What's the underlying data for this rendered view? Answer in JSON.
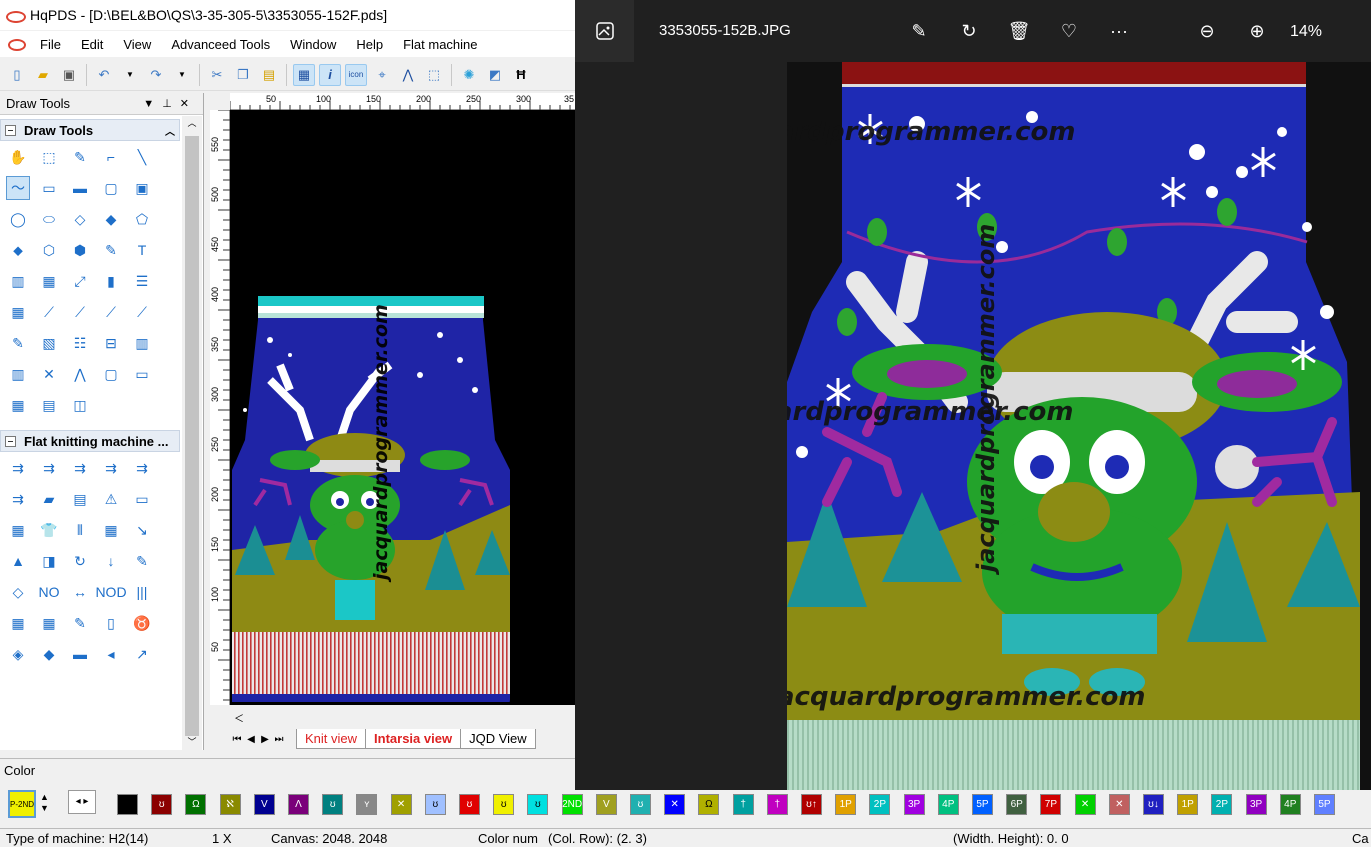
{
  "app": {
    "title": "HqPDS - [D:\\BEL&BO\\QS\\3-35-305-5\\3353055-152F.pds]",
    "menu": [
      "File",
      "Edit",
      "View",
      "Advanceed Tools",
      "Window",
      "Help",
      "Flat machine"
    ]
  },
  "toolbar": {
    "icons": [
      "new-file-icon",
      "open-folder-icon",
      "save-icon",
      "undo-icon",
      "redo-icon",
      "cut-icon",
      "copy-icon",
      "paste-icon",
      "grid-icon",
      "info-icon",
      "icon-mode-icon",
      "center-icon",
      "arc-icon",
      "select-icon",
      "snowflake-icon",
      "slash-icon",
      "h-icon"
    ]
  },
  "panel": {
    "title": "Draw Tools",
    "section_draw": "Draw Tools",
    "section_flat": "Flat knitting machine ...",
    "draw_tool_count": 43,
    "flat_tool_count": 35
  },
  "ruler": {
    "h_ticks": [
      "50",
      "100",
      "150",
      "200",
      "250",
      "300",
      "35"
    ],
    "v_ticks": [
      "550",
      "500",
      "450",
      "400",
      "350",
      "300",
      "250",
      "200",
      "150",
      "100",
      "50"
    ]
  },
  "tabs": {
    "knit": "Knit view",
    "intarsia": "Intarsia view",
    "jqd": "JQD View"
  },
  "color_panel": {
    "label": "Color",
    "current_label": "P-2ND",
    "swatches": [
      {
        "color": "#000000",
        "sym": ""
      },
      {
        "color": "#8b0000",
        "sym": "ʊ"
      },
      {
        "color": "#007000",
        "sym": "Ω"
      },
      {
        "color": "#8a8a00",
        "sym": "ℵ"
      },
      {
        "color": "#000090",
        "sym": "V"
      },
      {
        "color": "#7a007a",
        "sym": "Λ"
      },
      {
        "color": "#008080",
        "sym": "ʊ"
      },
      {
        "color": "#888888",
        "sym": "ʏ"
      },
      {
        "color": "#a0a000",
        "sym": "✕"
      },
      {
        "color": "#a0c0ff",
        "sym": "ʊ"
      },
      {
        "color": "#e00000",
        "sym": "ʊ"
      },
      {
        "color": "#f0f000",
        "sym": "ʊ"
      },
      {
        "color": "#00e0e0",
        "sym": "ʊ"
      },
      {
        "color": "#00e000",
        "sym": "2ND"
      },
      {
        "color": "#a0a020",
        "sym": "V"
      },
      {
        "color": "#20b0b0",
        "sym": "ʊ"
      },
      {
        "color": "#0000ff",
        "sym": "✕"
      },
      {
        "color": "#b0b000",
        "sym": "Ω"
      },
      {
        "color": "#00a0a0",
        "sym": "†"
      },
      {
        "color": "#c000c0",
        "sym": "†"
      },
      {
        "color": "#b00000",
        "sym": "ʊ↑"
      },
      {
        "color": "#e0a000",
        "sym": "1P"
      },
      {
        "color": "#00c0c0",
        "sym": "2P"
      },
      {
        "color": "#a000e0",
        "sym": "3P"
      },
      {
        "color": "#00c080",
        "sym": "4P"
      },
      {
        "color": "#0060ff",
        "sym": "5P"
      },
      {
        "color": "#406040",
        "sym": "6P"
      },
      {
        "color": "#d00000",
        "sym": "7P"
      },
      {
        "color": "#00d000",
        "sym": "✕"
      },
      {
        "color": "#c06060",
        "sym": "✕"
      },
      {
        "color": "#2020c0",
        "sym": "ʊ↓"
      },
      {
        "color": "#c0a000",
        "sym": "1P"
      },
      {
        "color": "#00b0b0",
        "sym": "2P"
      },
      {
        "color": "#9000c0",
        "sym": "3P"
      },
      {
        "color": "#208020",
        "sym": "4P"
      },
      {
        "color": "#6080ff",
        "sym": "5P"
      }
    ]
  },
  "status": {
    "machine": "Type of machine: H2(14)",
    "zoom": "1 X",
    "canvas": "Canvas: 2048. 2048",
    "color_num": "Color num",
    "col_row": "(Col. Row): (2. 3)",
    "width_height": "(Width. Height): 0. 0",
    "trail": "Ca"
  },
  "viewer": {
    "filename": "3353055-152B.JPG",
    "zoom": "14%",
    "icons": [
      "gallery-icon",
      "edit-image-icon",
      "rotate-icon",
      "delete-icon",
      "favorite-icon",
      "more-icon",
      "zoom-out-icon",
      "zoom-in-icon"
    ]
  },
  "watermark": {
    "text": "jacquardprogrammer.com",
    "text_partial": "jacquardprogrammer.com",
    "text_left": "acquardprogrammer.com",
    "text_mid": "ardprogrammer.com"
  }
}
